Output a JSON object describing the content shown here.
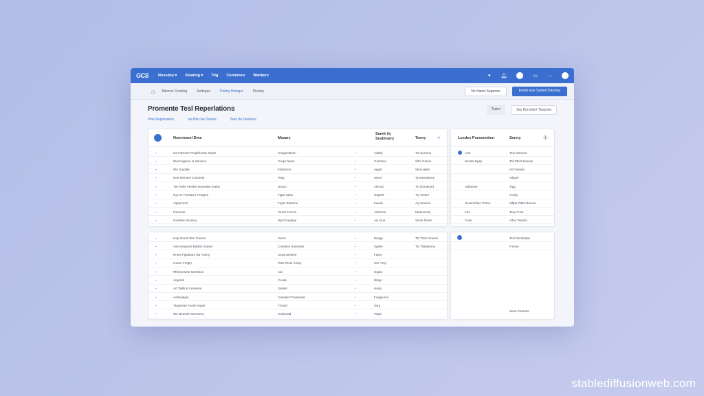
{
  "topbar": {
    "logo": "GCS",
    "nav": [
      "Nosedey ▾",
      "Steating ▾",
      "Trig",
      "Connimeo",
      "Wankers"
    ],
    "icons": [
      "pin-icon",
      "bell-icon",
      "avatar-icon",
      "monitor-icon",
      "arrow-icon",
      "user-icon"
    ]
  },
  "subbar": {
    "crumbs": [
      "Manner Coniting",
      "Sedegee",
      "Pontry Homger",
      "Pinstey"
    ],
    "btn_outline": "Nc Hanet Sepenon",
    "btn_primary": "Eniste Ese Sasted Dansiny"
  },
  "title": "Promente Tesl Reperlations",
  "title_buttons": [
    "Tsstre",
    "Sey Borontert Tlespote"
  ],
  "filters": [
    "Pine Repstraiens",
    "Ise Btet Ise Ssmes",
    "Sent Ite Desitoce"
  ],
  "left_header": {
    "col1": "Nsernowol Dms",
    "col2": "Mezary",
    "col3": "Samit ity\nSesbtratry",
    "col4": "Teeny"
  },
  "left_rows_top": [
    [
      "Ise Fstrnme Pmptfeonse Stepit",
      "Cnegsrolteon",
      "Aubby",
      "Tiz Sornron"
    ],
    [
      "Ntesnogmne ot Semese",
      "Coopr feene",
      "Cosrtosn",
      "Sitm Gsnoe"
    ],
    [
      "Nte Sroptite",
      "Eteesrme",
      "Ayget",
      "Sted selite"
    ],
    [
      "Nee Semnes Conmnte",
      "Tseg",
      "Sevrs",
      "Ty tnesodmey"
    ],
    [
      "Tte Fieler Fteshe Sesenttte Sseby",
      "Gssce",
      "Alecod",
      "Tn Scnoened"
    ],
    [
      "Nyx Sr Fsmiteen Feegere",
      "Fppe suibs",
      "Haperlt",
      "Try tnetee"
    ],
    [
      "Aipsmonst",
      "Frgse Bsntone",
      "Inasse",
      "Aiy tmesne"
    ],
    [
      "Fanesne",
      "Csscs Fomsn",
      "Astlonse",
      "Ppaesmoty"
    ],
    [
      "Guelitee Ssonery",
      "Htp Frsegtiop",
      "Aiy tone",
      "Ssnte fonee"
    ]
  ],
  "left_rows_bot": [
    [
      "Hap Snsstl Tem Tnesne",
      "Seors",
      "Bsega",
      "Ttz Tssm Srense"
    ],
    [
      "Ase Ienspone Bsditst Ssesel",
      "Crosteen Sesernes",
      "Sgshe",
      "Ttz Tsledeomy"
    ],
    [
      "Rmes Fgstteare Ilqr Tneny",
      "Csesnseniere",
      "Ftses"
    ],
    [
      "Hsese Fregry",
      "Tsse Rroel Creny",
      "Iser Yrny"
    ],
    [
      "Rferesnsete Seeelsce",
      "Atd",
      "Grgse"
    ],
    [
      "Argolsd",
      "Cesde",
      "Bstge"
    ],
    [
      "Art Tadls & Cerresse",
      "Ssdest",
      "Iesnp"
    ],
    [
      "Aolteedgen",
      "Creente Prtoiesnset",
      "Fuegie toil"
    ],
    [
      "Tsegrener Fassh Vrgse",
      "Trcesd",
      "Ssrg"
    ],
    [
      "Nte Beosrte Seesseny",
      "Sodsread",
      "Tsrpe"
    ]
  ],
  "right_header": {
    "col1": "Losdes Psessnetion",
    "col2": "Ssnny"
  },
  "right_rows_top": [
    [
      "Aott",
      "Tssi Stseene"
    ],
    [
      "Sesste Egsp",
      "Tsfi Ptsst Sensse"
    ],
    [
      "",
      "Ist Fsiesee"
    ],
    [
      "",
      "Vilepel"
    ],
    [
      "Aslbosne",
      "Tigg"
    ],
    [
      "",
      "Coelg"
    ],
    [
      "Sesenmfloe Trctee",
      "Mfpte Tstbe Bresse"
    ],
    [
      "Fas",
      "Tsey Fose"
    ],
    [
      "Cesn",
      "Aifeo Tserels"
    ]
  ],
  "right_rows_bot": [
    [
      "",
      "Tssil Seoblotpe"
    ],
    [
      "",
      "Fisnee"
    ],
    [
      "",
      "Sena Fiestsee"
    ]
  ],
  "watermark": "stablediffusionweb.com"
}
